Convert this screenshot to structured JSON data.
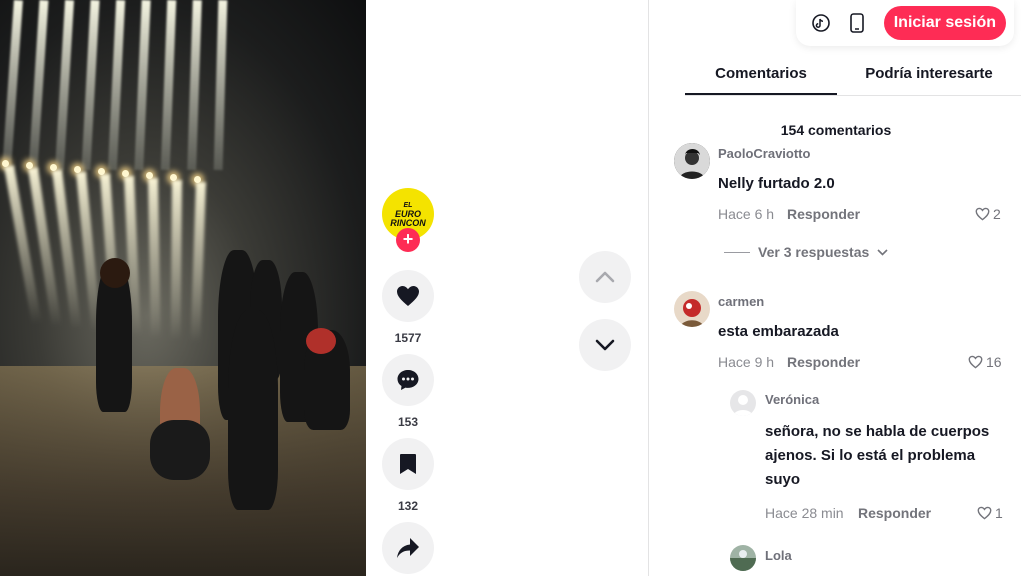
{
  "header": {
    "login_label": "Iniciar sesión",
    "icons": [
      "tiktok-icon",
      "phone-icon"
    ]
  },
  "creator": {
    "avatar_text": [
      "EL",
      "EURO",
      "RINCON"
    ],
    "follow_label": "+"
  },
  "actions": {
    "likes": "1577",
    "comments": "153",
    "saves": "132"
  },
  "tabs": [
    {
      "label": "Comentarios",
      "active": true
    },
    {
      "label": "Podría interesarte",
      "active": false
    }
  ],
  "comments_count": "154 comentarios",
  "comments": [
    {
      "user": "PaoloCraviotto",
      "text": "Nelly furtado 2.0",
      "time": "Hace 6 h",
      "reply_label": "Responder",
      "likes": "2",
      "view_replies": "Ver 3 respuestas"
    },
    {
      "user": "carmen",
      "text": "esta embarazada",
      "time": "Hace 9 h",
      "reply_label": "Responder",
      "likes": "16"
    },
    {
      "user": "Verónica",
      "text_lines": [
        "señora, no se habla de cuerpos",
        "ajenos. Si lo está el problema",
        "suyo"
      ],
      "time": "Hace 28 min",
      "reply_label": "Responder",
      "likes": "1"
    },
    {
      "user": "Lola"
    }
  ],
  "colors": {
    "brand": "#fe2c55",
    "avatar_yellow": "#f4e300",
    "button_gray": "#f1f1f2"
  }
}
